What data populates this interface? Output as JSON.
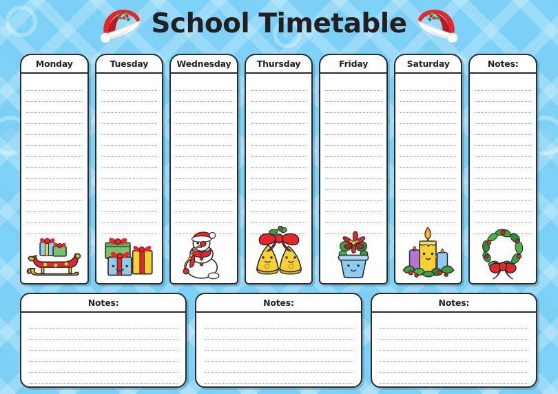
{
  "header": {
    "title": "School Timetable",
    "left_icon": "santa-hat-icon",
    "right_icon": "santa-hat-icon"
  },
  "theme": {
    "background_blue": "#7ed2f7",
    "pattern_blue": "#9fe0fb",
    "outline": "#2b2b2b",
    "card_white": "#ffffff",
    "title_color": "#231f20",
    "rule_color": "#9b9b9b",
    "christmas_red": "#e8262a",
    "christmas_green": "#3ba23b",
    "christmas_gold": "#f7d131"
  },
  "week": {
    "lines_per_column": 14,
    "columns": [
      {
        "label": "Monday",
        "icon": "santa-sleigh-with-gifts-icon",
        "lines": 14
      },
      {
        "label": "Tuesday",
        "icon": "gift-boxes-stack-icon",
        "lines": 14
      },
      {
        "label": "Wednesday",
        "icon": "snowman-with-santa-hat-icon",
        "lines": 14
      },
      {
        "label": "Thursday",
        "icon": "golden-christmas-bells-icon",
        "lines": 14
      },
      {
        "label": "Friday",
        "icon": "poinsettia-in-pot-icon",
        "lines": 14
      },
      {
        "label": "Saturday",
        "icon": "christmas-candles-icon",
        "lines": 14
      },
      {
        "label": "Notes:",
        "icon": "christmas-wreath-icon",
        "lines": 14
      }
    ]
  },
  "notes_row": [
    {
      "label": "Notes:",
      "lines": 6
    },
    {
      "label": "Notes:",
      "lines": 6
    },
    {
      "label": "Notes:",
      "lines": 6
    }
  ]
}
